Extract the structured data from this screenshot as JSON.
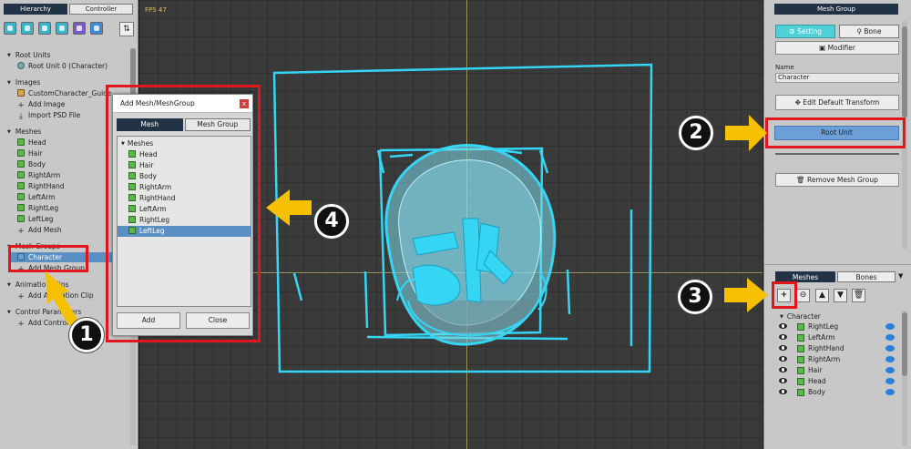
{
  "left_panel": {
    "tabs": [
      {
        "label": "Hierarchy"
      },
      {
        "label": "Controller"
      }
    ],
    "sections": {
      "root_units": {
        "title": "Root Units",
        "items": [
          "Root Unit 0 (Character)"
        ]
      },
      "images": {
        "title": "Images",
        "items": [
          "CustomCharacter_Guide",
          "Add Image",
          "Import PSD File"
        ]
      },
      "meshes": {
        "title": "Meshes",
        "items": [
          "Head",
          "Hair",
          "Body",
          "RightArm",
          "RightHand",
          "LeftArm",
          "RightLeg",
          "LeftLeg",
          "Add Mesh"
        ]
      },
      "mesh_groups": {
        "title": "Mesh Groups",
        "items": [
          "Character",
          "Add Mesh Group"
        ]
      },
      "animation": {
        "title": "Animation Clips",
        "items": [
          "Add Animation Clip"
        ]
      },
      "control_params": {
        "title": "Control Parameters",
        "items": [
          "Add Control Param"
        ]
      }
    }
  },
  "canvas": {
    "fps": "FPS 47"
  },
  "dialog": {
    "title": "Add Mesh/MeshGroup",
    "close": "x",
    "tabs": [
      {
        "label": "Mesh"
      },
      {
        "label": "Mesh Group"
      }
    ],
    "list_header": "Meshes",
    "items": [
      "Head",
      "Hair",
      "Body",
      "RightArm",
      "RightHand",
      "LeftArm",
      "RightLeg",
      "LeftLeg"
    ],
    "selected": "LeftLeg",
    "add_label": "Add",
    "close_label": "Close"
  },
  "right_panel": {
    "header": "Mesh Group",
    "tabs": [
      {
        "label": "Setting"
      },
      {
        "label": "Bone"
      }
    ],
    "modifier_label": "Modifier",
    "name_label": "Name",
    "name_value": "Character",
    "edit_transform_label": "Edit Default Transform",
    "root_unit_label": "Root Unit",
    "remove_label": "Remove Mesh Group",
    "bottom_tabs": [
      {
        "label": "Meshes"
      },
      {
        "label": "Bones"
      }
    ],
    "dropdown": "▼",
    "tree_header": "Character",
    "mesh_list": [
      "RightLeg",
      "LeftArm",
      "RightHand",
      "RightArm",
      "Hair",
      "Head",
      "Body"
    ]
  },
  "annotations": {
    "n1": "1",
    "n2": "2",
    "n3": "3",
    "n4": "4"
  },
  "colors": {
    "accent_red": "#e0161c",
    "arrow_yellow": "#f5c000",
    "mesh_cyan": "#35d6f4",
    "selection_blue": "#5a8fc3"
  }
}
